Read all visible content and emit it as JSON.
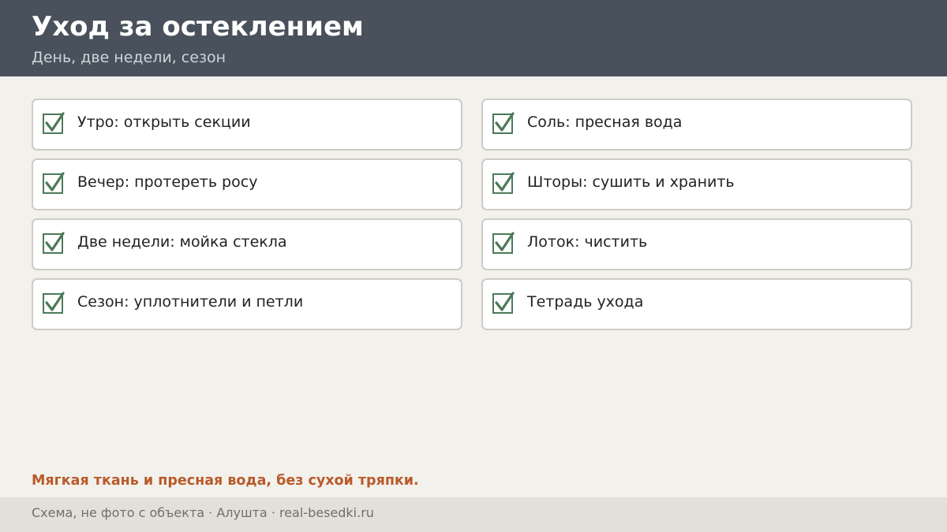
{
  "header": {
    "title": "Уход за остеклением",
    "subtitle": "День, две недели, сезон"
  },
  "checklist": {
    "left": [
      {
        "label": "Утро: открыть секции",
        "checked": true
      },
      {
        "label": "Вечер: протереть росу",
        "checked": true
      },
      {
        "label": "Две недели: мойка стекла",
        "checked": true
      },
      {
        "label": "Сезон: уплотнители и петли",
        "checked": true
      }
    ],
    "right": [
      {
        "label": "Соль: пресная вода",
        "checked": true
      },
      {
        "label": "Шторы: сушить и хранить",
        "checked": true
      },
      {
        "label": "Лоток: чистить",
        "checked": true
      },
      {
        "label": "Тетрадь ухода",
        "checked": true
      }
    ]
  },
  "note": "Мягкая ткань и пресная вода, без сухой тряпки.",
  "footer": {
    "text": "Схема, не фото с объекта  ·  Алушта  ·  real-besedki.ru"
  },
  "colors": {
    "header_bg": "#48515c",
    "page_bg": "#f3f1ec",
    "check_green": "#4c7a57",
    "accent_orange": "#b85a2a",
    "footer_bg": "#e3e0d9"
  },
  "icons": {
    "check": "checkbox-checked-icon"
  }
}
